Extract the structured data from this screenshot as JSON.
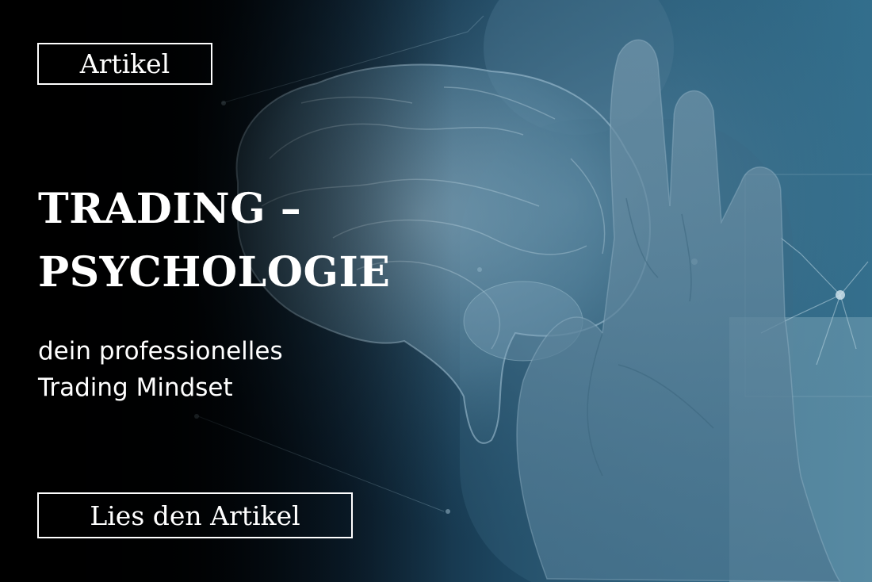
{
  "banner": {
    "tag_label": "Artikel",
    "title_line_1": "TRADING –",
    "title_line_2": "PSYCHOLOGIE",
    "subtitle_line_1": "dein professionelles",
    "subtitle_line_2": "Trading Mindset",
    "cta_label": "Lies den Artikel",
    "image_subject": "brain-hologram-and-hand",
    "colors": {
      "text": "#ffffff",
      "background_dark": "#000000",
      "background_tint": "#2a5f7c"
    }
  }
}
